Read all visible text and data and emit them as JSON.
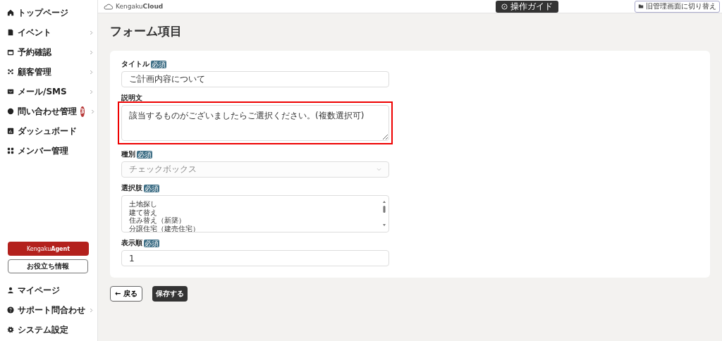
{
  "sidebar": {
    "items": [
      {
        "label": "トップページ",
        "has_submenu": false
      },
      {
        "label": "イベント",
        "has_submenu": true
      },
      {
        "label": "予約確認",
        "has_submenu": true
      },
      {
        "label": "顧客管理",
        "has_submenu": true
      },
      {
        "label": "メール/SMS",
        "has_submenu": true
      },
      {
        "label": "問い合わせ管理",
        "has_submenu": true,
        "badge": "3"
      },
      {
        "label": "ダッシュボード",
        "has_submenu": false
      },
      {
        "label": "メンバー管理",
        "has_submenu": false
      }
    ],
    "agent_button": {
      "brand_light": "Kengaku",
      "brand_bold": "Agent"
    },
    "info_button": "お役立ち情報",
    "bottom_items": [
      {
        "label": "マイページ",
        "has_submenu": false
      },
      {
        "label": "サポート問合わせ",
        "has_submenu": true
      },
      {
        "label": "システム設定",
        "has_submenu": false
      }
    ]
  },
  "header": {
    "logo_light": "Kengaku",
    "logo_bold": "Cloud",
    "guide_button": "操作ガイド",
    "switch_button": "旧管理画面に切り替え"
  },
  "page_title": "フォーム項目",
  "form": {
    "title_field": {
      "label": "タイトル",
      "badge": "必須",
      "value": "ご計画内容について"
    },
    "description_field": {
      "label": "説明文",
      "value": "該当するものがございましたらご選択ください。(複数選択可)",
      "highlighted": true
    },
    "type_field": {
      "label": "種別",
      "badge": "必須",
      "value": "チェックボックス",
      "disabled": true
    },
    "choices_field": {
      "label": "選択肢",
      "badge": "必須",
      "lines": [
        "土地探し",
        "建て替え",
        "住み替え（新築）",
        "分譲住宅（建売住宅）"
      ]
    },
    "order_field": {
      "label": "表示順",
      "badge": "必須",
      "value": "1"
    }
  },
  "buttons": {
    "back": "← 戻る",
    "save": "保存する"
  }
}
